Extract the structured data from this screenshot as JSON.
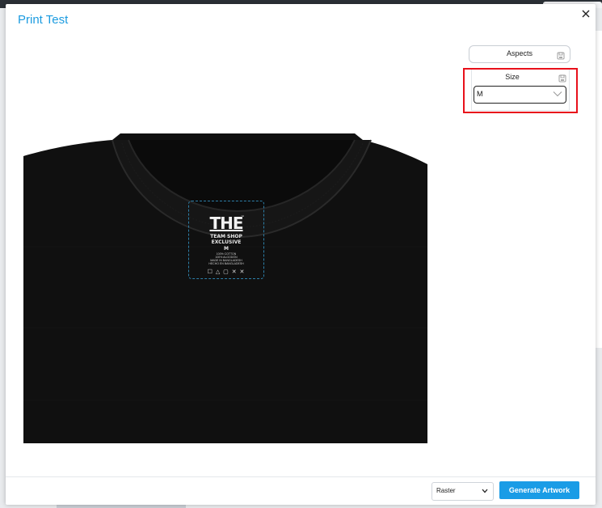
{
  "modal": {
    "title": "Print Test",
    "close_icon": "close-icon"
  },
  "aspects": {
    "label": "Aspects",
    "icon": "save-icon"
  },
  "size": {
    "label": "Size",
    "selected": "M",
    "icon": "save-icon"
  },
  "preview": {
    "label_lines": {
      "brand": "THE",
      "tm": "™",
      "line1": "TEAM SHOP",
      "line2": "EXCLUSIVE",
      "size": "M",
      "small1": "100% COTTON",
      "small2": "100% ALGODÓN",
      "small3": "MADE IN BANGLADESH",
      "small4": "HECHO EN BANGLADESH",
      "icons": "☐ △ ▢ ✕ ✕"
    }
  },
  "footer": {
    "format_selected": "Raster",
    "generate_label": "Generate Artwork"
  },
  "colors": {
    "accent": "#1a9ce6",
    "highlight": "#e8101a",
    "shirt": "#0f0f0f"
  }
}
